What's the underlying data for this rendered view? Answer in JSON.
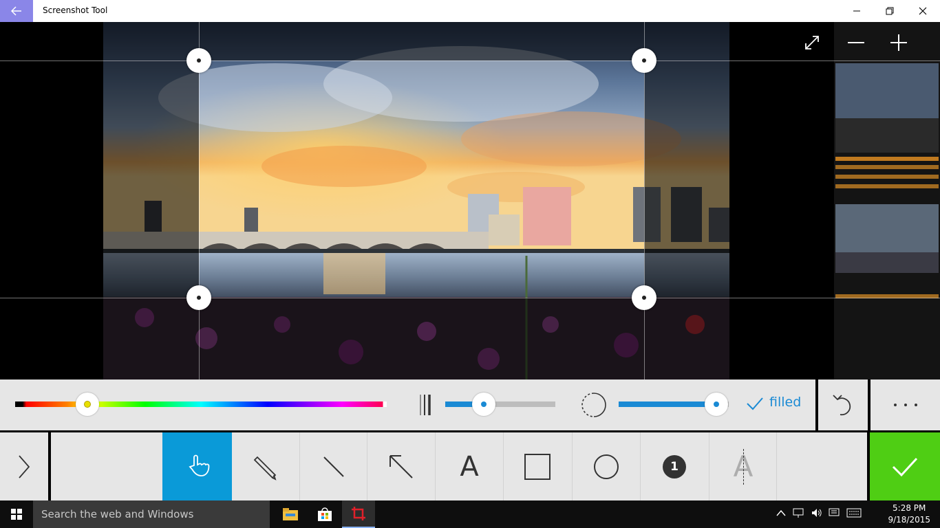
{
  "window": {
    "title": "Screenshot Tool",
    "back_icon": "back-arrow-icon",
    "minimize_icon": "minimize-icon",
    "restore_icon": "restore-icon",
    "close_icon": "close-icon"
  },
  "canvas": {
    "controls": [
      "expand-icon",
      "zoom-out-icon",
      "zoom-in-icon"
    ]
  },
  "options": {
    "filled_label": "filled",
    "color_picker_position": 0.19,
    "thickness_level": 0.35,
    "opacity_level": 0.88,
    "accent_color": "#1a8ad4",
    "more_label": "..."
  },
  "tools": {
    "items": [
      {
        "name": "hand",
        "icon": "hand-pan-icon",
        "selected": true
      },
      {
        "name": "pencil",
        "icon": "pencil-icon"
      },
      {
        "name": "line",
        "icon": "line-icon"
      },
      {
        "name": "arrow",
        "icon": "arrow-icon"
      },
      {
        "name": "text",
        "icon": "text-icon",
        "label": "A"
      },
      {
        "name": "rectangle",
        "icon": "rectangle-icon"
      },
      {
        "name": "ellipse",
        "icon": "ellipse-icon"
      },
      {
        "name": "counter",
        "icon": "number-badge-icon",
        "label": "1"
      },
      {
        "name": "blur",
        "icon": "blur-text-icon",
        "label": "A"
      }
    ],
    "selected_color": "#0a9ad8",
    "confirm_color": "#4fce14"
  },
  "taskbar": {
    "search_placeholder": "Search the web and Windows",
    "time": "5:28 PM",
    "date": "9/18/2015"
  }
}
